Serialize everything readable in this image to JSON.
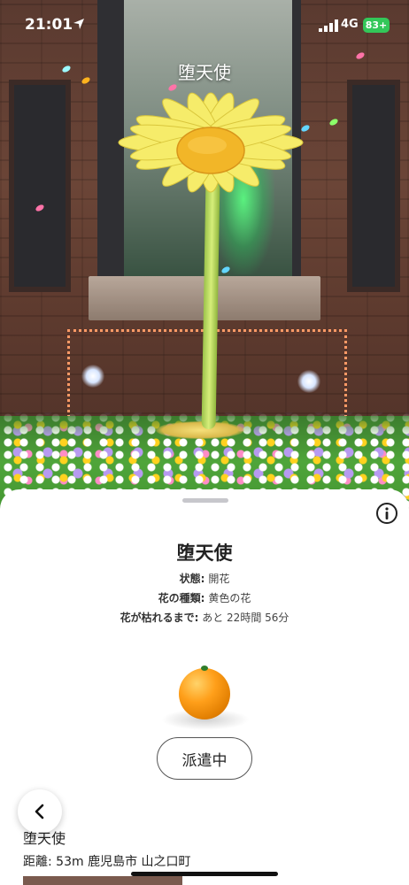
{
  "status_bar": {
    "time": "21:01",
    "network": "4G",
    "battery": "83+"
  },
  "ar_view": {
    "flower_name": "堕天使"
  },
  "sheet": {
    "title": "堕天使",
    "rows": [
      {
        "label": "状態:",
        "value": "開花"
      },
      {
        "label": "花の種類:",
        "value": "黄色の花"
      },
      {
        "label": "花が枯れるまで:",
        "value": "あと 22時間 56分"
      }
    ],
    "dispatch_button": "派遣中"
  },
  "location": {
    "name": "堕天使",
    "distance": "距離: 53m 鹿児島市 山之口町"
  },
  "colors": {
    "accent_green": "#33c759",
    "orb_orange": "#ff9f1a",
    "daisy_yellow": "#f6ec6a"
  },
  "icons": {
    "location": "location-arrow-icon",
    "info": "info-circle-icon",
    "back": "chevron-left-icon"
  }
}
